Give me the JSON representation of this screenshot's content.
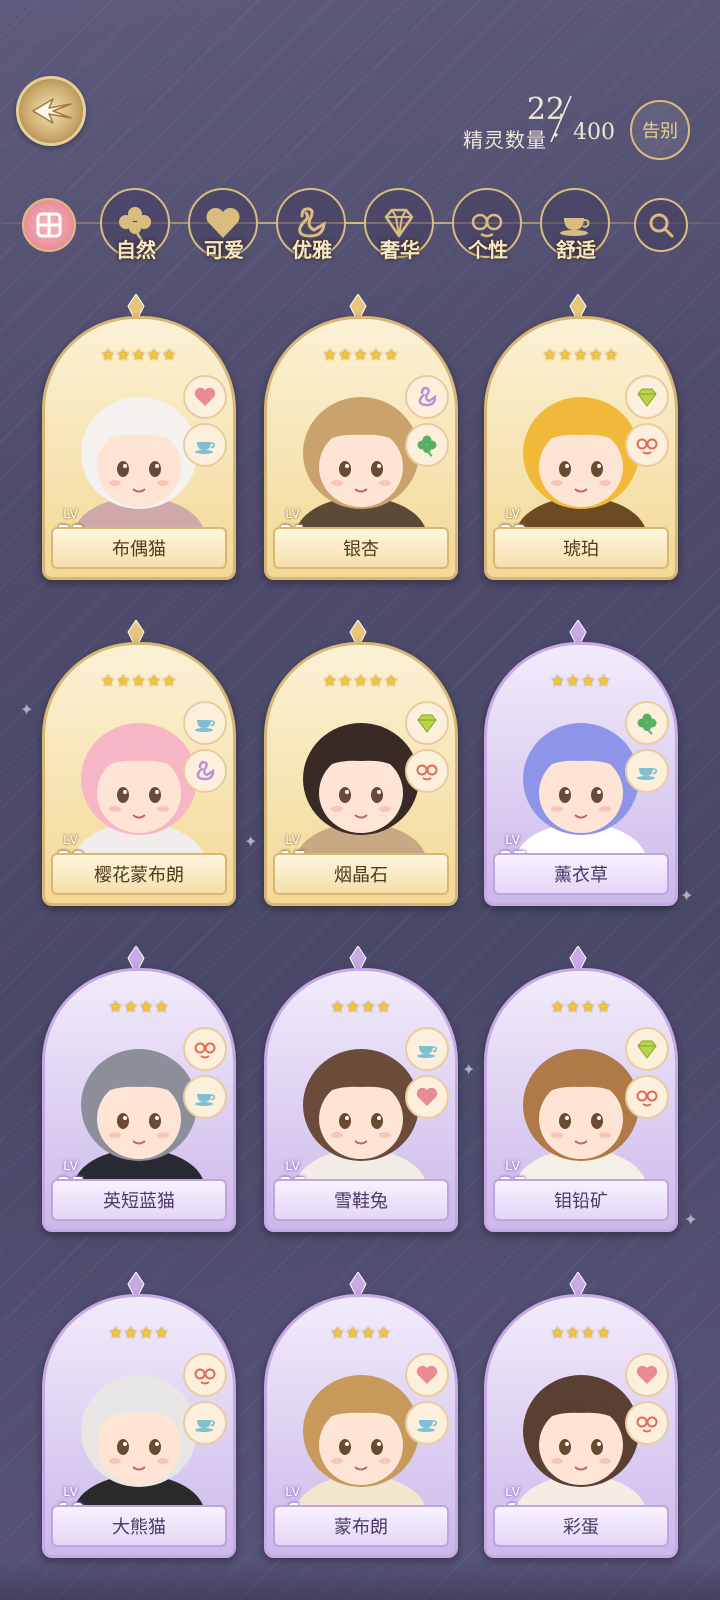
{
  "header": {
    "back_icon": "wing-arrow-back-icon",
    "count_current": "22",
    "count_total": "400",
    "count_label": "精灵数量",
    "farewell_label": "告别"
  },
  "filters": [
    {
      "key": "all",
      "icon": "gift-grid-icon",
      "label": ""
    },
    {
      "key": "nature",
      "icon": "clover-icon",
      "label": "自然"
    },
    {
      "key": "cute",
      "icon": "heart-icon",
      "label": "可爱"
    },
    {
      "key": "elegant",
      "icon": "swan-icon",
      "label": "优雅"
    },
    {
      "key": "luxury",
      "icon": "diamond-icon",
      "label": "奢华"
    },
    {
      "key": "personality",
      "icon": "glasses-face-icon",
      "label": "个性"
    },
    {
      "key": "comfort",
      "icon": "teacup-icon",
      "label": "舒适"
    },
    {
      "key": "search",
      "icon": "search-icon",
      "label": ""
    }
  ],
  "spirits": [
    {
      "name": "布偶猫",
      "lv_label": "LV",
      "level": "33",
      "stars": "★★★★★",
      "rarity": "gold",
      "traits": [
        "heart-icon",
        "teacup-icon"
      ],
      "hair": "#f5f1ee",
      "accent": "#cfa8a8"
    },
    {
      "name": "银杏",
      "lv_label": "LV",
      "level": "31",
      "stars": "★★★★★",
      "rarity": "gold",
      "traits": [
        "swan-icon",
        "clover-icon"
      ],
      "hair": "#c9a36b",
      "accent": "#5b4a35"
    },
    {
      "name": "琥珀",
      "lv_label": "LV",
      "level": "22",
      "stars": "★★★★★",
      "rarity": "gold",
      "traits": [
        "diamond-icon",
        "glasses-face-icon"
      ],
      "hair": "#f0b93a",
      "accent": "#6b4a24"
    },
    {
      "name": "樱花蒙布朗",
      "lv_label": "LV",
      "level": "20",
      "stars": "★★★★★",
      "rarity": "gold",
      "traits": [
        "teacup-icon",
        "swan-icon"
      ],
      "hair": "#f6b6c6",
      "accent": "#f2ecec"
    },
    {
      "name": "烟晶石",
      "lv_label": "LV",
      "level": "15",
      "stars": "★★★★★",
      "rarity": "gold",
      "traits": [
        "diamond-icon",
        "glasses-face-icon"
      ],
      "hair": "#3a2a25",
      "accent": "#c9a884"
    },
    {
      "name": "薰衣草",
      "lv_label": "LV",
      "level": "27",
      "stars": "★★★★",
      "rarity": "purple",
      "traits": [
        "clover-icon",
        "teacup-icon"
      ],
      "hair": "#8e95e8",
      "accent": "#ffffff"
    },
    {
      "name": "英短蓝猫",
      "lv_label": "LV",
      "level": "25",
      "stars": "★★★★",
      "rarity": "purple",
      "traits": [
        "glasses-face-icon",
        "teacup-icon"
      ],
      "hair": "#8c8f9a",
      "accent": "#2a2a34"
    },
    {
      "name": "雪鞋兔",
      "lv_label": "LV",
      "level": "25",
      "stars": "★★★★",
      "rarity": "purple",
      "traits": [
        "teacup-icon",
        "heart-icon"
      ],
      "hair": "#6b4c3a",
      "accent": "#f2ece6"
    },
    {
      "name": "钼铅矿",
      "lv_label": "LV",
      "level": "25",
      "stars": "★★★★",
      "rarity": "purple",
      "traits": [
        "diamond-icon",
        "glasses-face-icon"
      ],
      "hair": "#b07a48",
      "accent": "#f4f0e8"
    },
    {
      "name": "大熊猫",
      "lv_label": "LV",
      "level": "10",
      "stars": "★★★★",
      "rarity": "purple",
      "traits": [
        "glasses-face-icon",
        "teacup-icon"
      ],
      "hair": "#e8e6e4",
      "accent": "#2a2a2a"
    },
    {
      "name": "蒙布朗",
      "lv_label": "LV",
      "level": "6",
      "stars": "★★★★",
      "rarity": "purple",
      "traits": [
        "heart-icon",
        "teacup-icon"
      ],
      "hair": "#c79a5c",
      "accent": "#f3e6cf"
    },
    {
      "name": "彩蛋",
      "lv_label": "LV",
      "level": "1",
      "stars": "★★★★",
      "rarity": "purple",
      "traits": [
        "heart-icon",
        "glasses-face-icon"
      ],
      "hair": "#5a3f33",
      "accent": "#f7ece4"
    }
  ]
}
